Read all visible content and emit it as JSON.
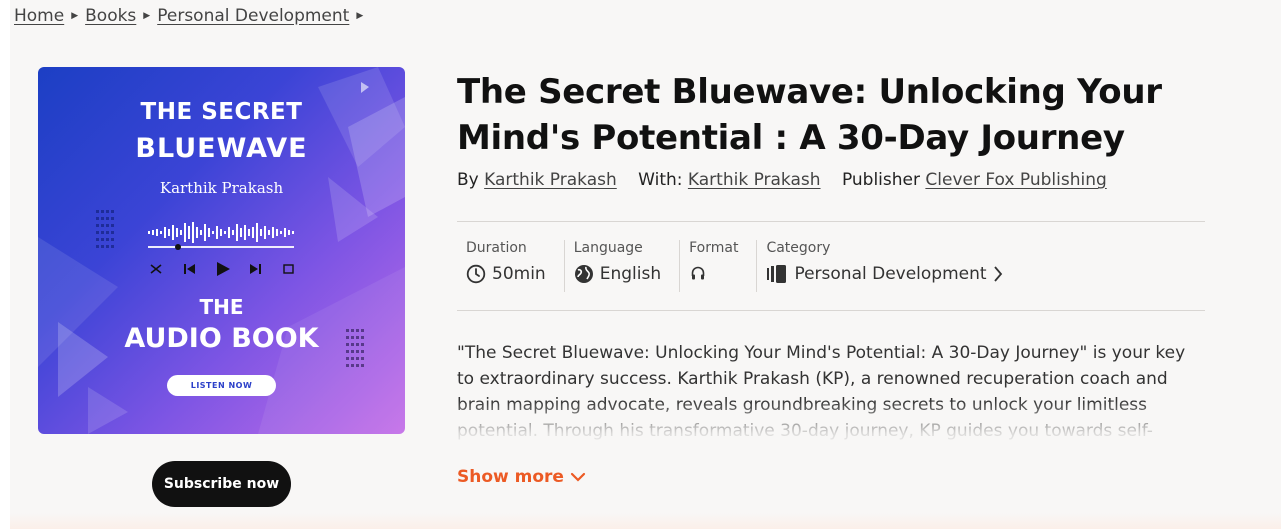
{
  "breadcrumb": [
    {
      "label": "Home"
    },
    {
      "label": "Books"
    },
    {
      "label": "Personal Development"
    }
  ],
  "cover": {
    "title_line1": "THE SECRET",
    "title_line2": "BLUEWAVE",
    "author": "Karthik Prakash",
    "subtitle_line1": "THE",
    "subtitle_line2": "AUDIO BOOK",
    "listen_label": "LISTEN NOW"
  },
  "book": {
    "title": "The Secret Bluewave: Unlocking Your Mind's Potential : A 30-Day Journey",
    "by_label": "By",
    "author": "Karthik Prakash",
    "with_label": "With:",
    "narrator": "Karthik Prakash",
    "publisher_label": "Publisher",
    "publisher": "Clever Fox Publishing"
  },
  "meta": {
    "duration_label": "Duration",
    "duration_value": "50min",
    "language_label": "Language",
    "language_value": "English",
    "format_label": "Format",
    "category_label": "Category",
    "category_value": "Personal Development"
  },
  "description": "\"The Secret Bluewave: Unlocking Your Mind's Potential: A 30-Day Journey\" is your key to extraordinary success. Karthik Prakash (KP), a renowned recuperation coach and brain mapping advocate, reveals groundbreaking secrets to unlock your limitless potential. Through his transformative 30-day journey, KP guides you towards self-",
  "actions": {
    "show_more": "Show more",
    "subscribe": "Subscribe now"
  },
  "colors": {
    "accent": "#ec5a24",
    "button_bg": "#111111",
    "page_bg": "#f8f7f6"
  }
}
